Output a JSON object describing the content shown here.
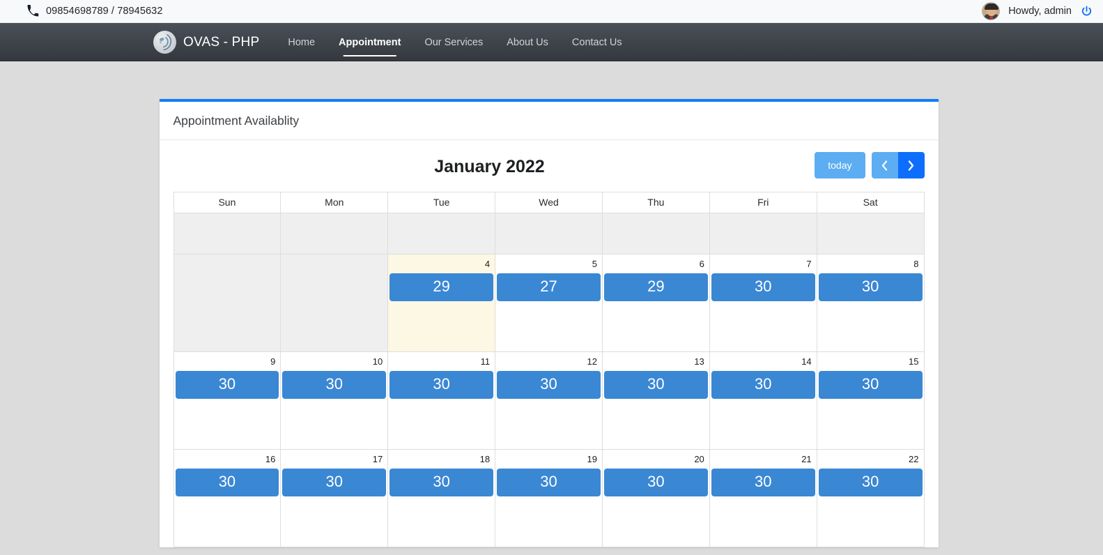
{
  "topbar": {
    "phone_icon": "phone-icon",
    "phone": "09854698789 / 78945632",
    "greeting": "Howdy, admin",
    "power_icon": "power-icon",
    "avatar_alt": "admin-avatar"
  },
  "nav": {
    "brand": "OVAS - PHP",
    "logo_icon": "ovas-logo-icon",
    "items": [
      {
        "label": "Home",
        "active": false
      },
      {
        "label": "Appointment",
        "active": true
      },
      {
        "label": "Our Services",
        "active": false
      },
      {
        "label": "About Us",
        "active": false
      },
      {
        "label": "Contact Us",
        "active": false
      }
    ]
  },
  "panel": {
    "title": "Appointment Availablity"
  },
  "calendar": {
    "title": "January 2022",
    "today_label": "today",
    "prev_icon": "chevron-left-icon",
    "next_icon": "chevron-right-icon",
    "day_headers": [
      "Sun",
      "Mon",
      "Tue",
      "Wed",
      "Thu",
      "Fri",
      "Sat"
    ],
    "weeks": [
      {
        "height": "w-empty",
        "days": [
          {
            "num": "",
            "event": "",
            "state": "other"
          },
          {
            "num": "",
            "event": "",
            "state": "other"
          },
          {
            "num": "",
            "event": "",
            "state": "other"
          },
          {
            "num": "",
            "event": "",
            "state": "other"
          },
          {
            "num": "",
            "event": "",
            "state": "other"
          },
          {
            "num": "",
            "event": "",
            "state": "other"
          },
          {
            "num": "",
            "event": "",
            "state": "other"
          }
        ]
      },
      {
        "height": "w-tall",
        "days": [
          {
            "num": "",
            "event": "",
            "state": "other"
          },
          {
            "num": "",
            "event": "",
            "state": "other"
          },
          {
            "num": "4",
            "event": "29",
            "state": "today"
          },
          {
            "num": "5",
            "event": "27",
            "state": "normal"
          },
          {
            "num": "6",
            "event": "29",
            "state": "normal"
          },
          {
            "num": "7",
            "event": "30",
            "state": "normal"
          },
          {
            "num": "8",
            "event": "30",
            "state": "normal"
          }
        ]
      },
      {
        "height": "w-std",
        "days": [
          {
            "num": "9",
            "event": "30",
            "state": "normal"
          },
          {
            "num": "10",
            "event": "30",
            "state": "normal"
          },
          {
            "num": "11",
            "event": "30",
            "state": "normal"
          },
          {
            "num": "12",
            "event": "30",
            "state": "normal"
          },
          {
            "num": "13",
            "event": "30",
            "state": "normal"
          },
          {
            "num": "14",
            "event": "30",
            "state": "normal"
          },
          {
            "num": "15",
            "event": "30",
            "state": "normal"
          }
        ]
      },
      {
        "height": "w-std",
        "days": [
          {
            "num": "16",
            "event": "30",
            "state": "normal"
          },
          {
            "num": "17",
            "event": "30",
            "state": "normal"
          },
          {
            "num": "18",
            "event": "30",
            "state": "normal"
          },
          {
            "num": "19",
            "event": "30",
            "state": "normal"
          },
          {
            "num": "20",
            "event": "30",
            "state": "normal"
          },
          {
            "num": "21",
            "event": "30",
            "state": "normal"
          },
          {
            "num": "22",
            "event": "30",
            "state": "normal"
          }
        ]
      }
    ]
  },
  "colors": {
    "accent_blue": "#0d7ef5",
    "event_blue": "#3a87d4",
    "next_button_blue": "#0d6efd",
    "light_button_blue": "#5cadf2",
    "today_cell": "#fcf8e3",
    "other_month_cell": "#efefef",
    "page_background": "#dcdcdc",
    "navbar_dark": "#3e434a"
  }
}
